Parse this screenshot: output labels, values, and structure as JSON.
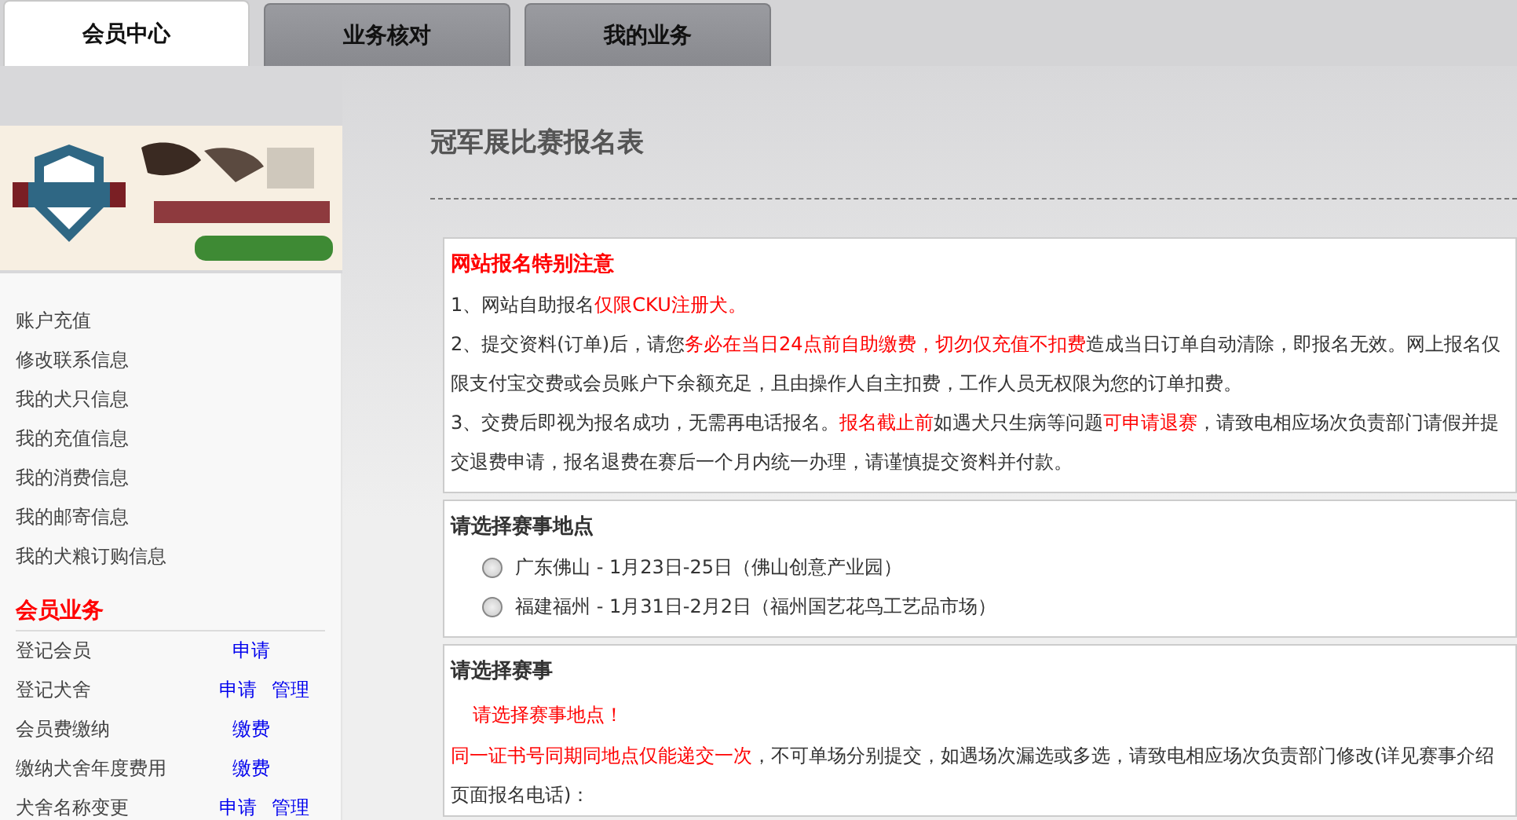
{
  "tabs": [
    {
      "label": "会员中心",
      "selected": true
    },
    {
      "label": "业务核对",
      "selected": false
    },
    {
      "label": "我的业务",
      "selected": false
    }
  ],
  "sidebar": {
    "menu_items": [
      "账户充值",
      "修改联系信息",
      "我的犬只信息",
      "我的充值信息",
      "我的消费信息",
      "我的邮寄信息",
      "我的犬粮订购信息"
    ],
    "section_title": "会员业务",
    "business_rows": [
      {
        "label": "登记会员",
        "links": [
          "申请"
        ]
      },
      {
        "label": "登记犬舍",
        "links": [
          "申请",
          "管理"
        ]
      },
      {
        "label": "会员费缴纳",
        "links": [
          "缴费"
        ]
      },
      {
        "label": "缴纳犬舍年度费用",
        "links": [
          "缴费"
        ]
      },
      {
        "label": "犬舍名称变更",
        "links": [
          "申请",
          "管理"
        ]
      }
    ]
  },
  "main": {
    "title": "冠军展比赛报名表",
    "notice": {
      "heading": "网站报名特别注意",
      "paragraphs": [
        [
          {
            "text": "1、网站自助报名",
            "emphasis": false
          },
          {
            "text": "仅限CKU注册犬。",
            "emphasis": true
          }
        ],
        [
          {
            "text": "2、提交资料(订单)后，请您",
            "emphasis": false
          },
          {
            "text": "务必在当日24点前自助缴费，切勿仅充值不扣费",
            "emphasis": true
          },
          {
            "text": "造成当日订单自动清除，即报名无效。网上报名仅限支付宝交费或会员账户下余额充足，且由操作人自主扣费，工作人员无权限为您的订单扣费。",
            "emphasis": false
          }
        ],
        [
          {
            "text": "3、交费后即视为报名成功，无需再电话报名。",
            "emphasis": false
          },
          {
            "text": "报名截止前",
            "emphasis": true
          },
          {
            "text": "如遇犬只生病等问题",
            "emphasis": false
          },
          {
            "text": "可申请退赛",
            "emphasis": true
          },
          {
            "text": "，请致电相应场次负责部门请假并提交退费申请，报名退费在赛后一个月内统一办理，请谨慎提交资料并付款。",
            "emphasis": false
          }
        ]
      ]
    },
    "location": {
      "heading": "请选择赛事地点",
      "options": [
        {
          "label": "广东佛山 - 1月23日-25日（佛山创意产业园）",
          "selected": false
        },
        {
          "label": "福建福州 - 1月31日-2月2日（福州国艺花鸟工艺品市场）",
          "selected": false
        }
      ]
    },
    "event": {
      "heading": "请选择赛事",
      "prompt": "请选择赛事地点！",
      "note": [
        {
          "text": "同一证书号同期同地点仅能递交一次",
          "emphasis": true
        },
        {
          "text": "，不可单场分别提交，如遇场次漏选或多选，请致电相应场次负责部门修改(详见赛事介绍页面报名电话)：",
          "emphasis": false
        }
      ]
    }
  }
}
